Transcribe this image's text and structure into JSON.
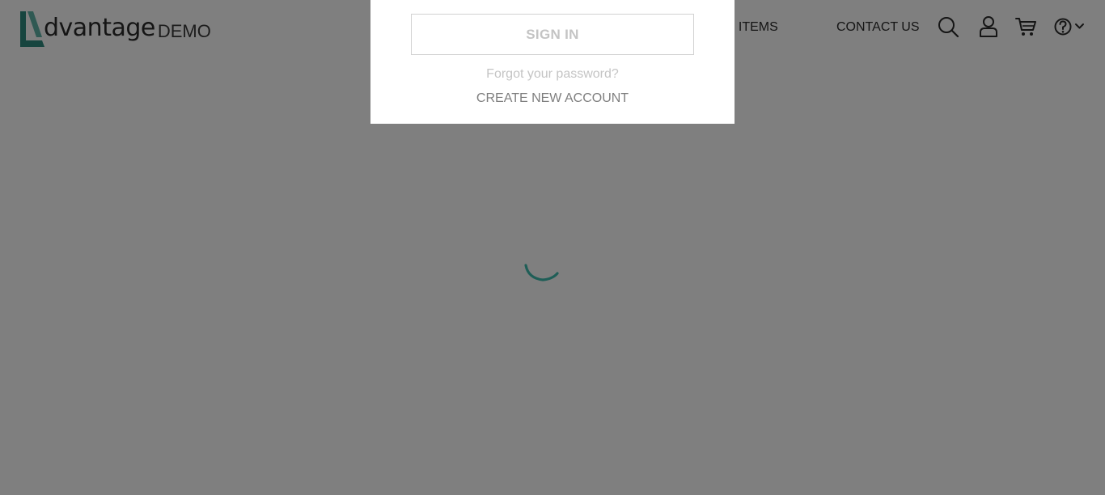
{
  "header": {
    "logo_text": "dvantage",
    "logo_demo": "DEMO",
    "nav": {
      "popular_items": "POPULAR ITEMS",
      "contact_us": "CONTACT US"
    },
    "icons": [
      "search-icon",
      "user-icon",
      "cart-icon",
      "help-icon",
      "chevron-down-icon"
    ]
  },
  "login_popup": {
    "sign_in_label": "SIGN IN",
    "forgot_password": "Forgot your password?",
    "create_account": "CREATE NEW ACCOUNT"
  },
  "loading": {
    "icon": "loading-spinner-icon"
  },
  "colors": {
    "brand_teal": "#2e8b7f",
    "overlay": "rgba(0,0,0,0.5)",
    "text_dark": "#2b2b2b",
    "muted_text": "#c4c4c4"
  }
}
